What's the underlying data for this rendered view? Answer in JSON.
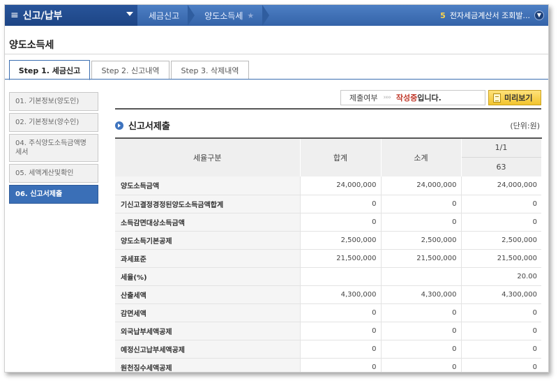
{
  "topbar": {
    "menu_title": "신고/납부",
    "breadcrumbs": [
      "세금신고",
      "양도소득세"
    ],
    "notice_count": "5",
    "notice_text": "전자세금계산서 조회발..."
  },
  "page_title": "양도소득세",
  "tabs": [
    {
      "label": "Step 1. 세금신고",
      "active": true
    },
    {
      "label": "Step 2. 신고내역",
      "active": false
    },
    {
      "label": "Step 3. 삭제내역",
      "active": false
    }
  ],
  "sidebar": {
    "items": [
      {
        "label": "01. 기본정보(양도인)",
        "active": false
      },
      {
        "label": "02. 기본정보(양수인)",
        "active": false
      },
      {
        "label": "04. 주식양도소득금액명세서",
        "active": false
      },
      {
        "label": "05. 세액계산및확인",
        "active": false
      },
      {
        "label": "06. 신고서제출",
        "active": true
      }
    ]
  },
  "status": {
    "label": "제출여부",
    "arrows": "››››",
    "value": "작성중",
    "suffix": "입니다."
  },
  "preview_button": "미리보기",
  "section": {
    "title": "신고서제출",
    "unit": "(단위:원)"
  },
  "table": {
    "headers": {
      "category": "세율구분",
      "total": "합계",
      "subtotal": "소계",
      "page": "1/1",
      "code": "63"
    },
    "rows": [
      {
        "label": "양도소득금액",
        "total": "24,000,000",
        "subtotal": "24,000,000",
        "col": "24,000,000"
      },
      {
        "label": "기신고결정경정된양도소득금액합계",
        "total": "0",
        "subtotal": "0",
        "col": "0"
      },
      {
        "label": "소득감면대상소득금액",
        "total": "0",
        "subtotal": "0",
        "col": "0"
      },
      {
        "label": "양도소득기본공제",
        "total": "2,500,000",
        "subtotal": "2,500,000",
        "col": "2,500,000"
      },
      {
        "label": "과세표준",
        "total": "21,500,000",
        "subtotal": "21,500,000",
        "col": "21,500,000"
      },
      {
        "label": "세율(%)",
        "total": "",
        "subtotal": "",
        "col": "20.00"
      },
      {
        "label": "산출세액",
        "total": "4,300,000",
        "subtotal": "4,300,000",
        "col": "4,300,000"
      },
      {
        "label": "감면세액",
        "total": "0",
        "subtotal": "0",
        "col": "0"
      },
      {
        "label": "외국납부세액공제",
        "total": "0",
        "subtotal": "0",
        "col": "0"
      },
      {
        "label": "예정신고납부세액공제",
        "total": "0",
        "subtotal": "0",
        "col": "0"
      },
      {
        "label": "원천징수세액공제",
        "total": "0",
        "subtotal": "0",
        "col": "0"
      }
    ]
  }
}
